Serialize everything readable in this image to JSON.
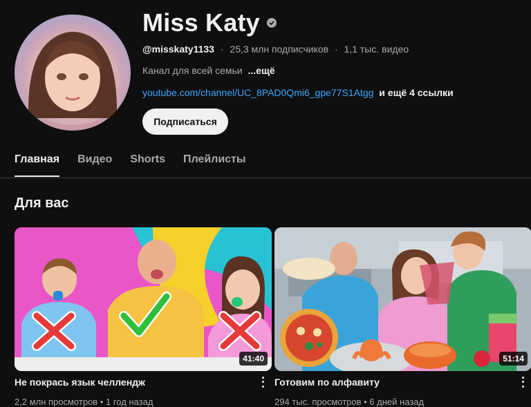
{
  "channel": {
    "title": "Miss Katy",
    "handle": "@misskaty1133",
    "subscribers": "25,3 млн подписчиков",
    "videos_count": "1,1 тыс. видео",
    "description": "Канал для всей семьи",
    "description_more": "...ещё",
    "link": "youtube.com/channel/UC_8PAD0Qmi6_gpe77S1Atgg",
    "more_links": "и ещё 4 ссылки",
    "subscribe_label": "Подписаться"
  },
  "tabs": [
    {
      "label": "Главная",
      "active": true
    },
    {
      "label": "Видео",
      "active": false
    },
    {
      "label": "Shorts",
      "active": false
    },
    {
      "label": "Плейлисты",
      "active": false
    }
  ],
  "section": {
    "title": "Для вас"
  },
  "videos": [
    {
      "title": "Не покрась язык челлендж",
      "duration": "41:40",
      "stats": "2,2 млн просмотров • 1 год назад"
    },
    {
      "title": "Готовим по алфавиту",
      "duration": "51:14",
      "stats": "294 тыс. просмотров • 6 дней назад"
    }
  ],
  "colors": {
    "background": "#0f0f0f",
    "link": "#3ea6ff",
    "muted": "#aaaaaa"
  }
}
